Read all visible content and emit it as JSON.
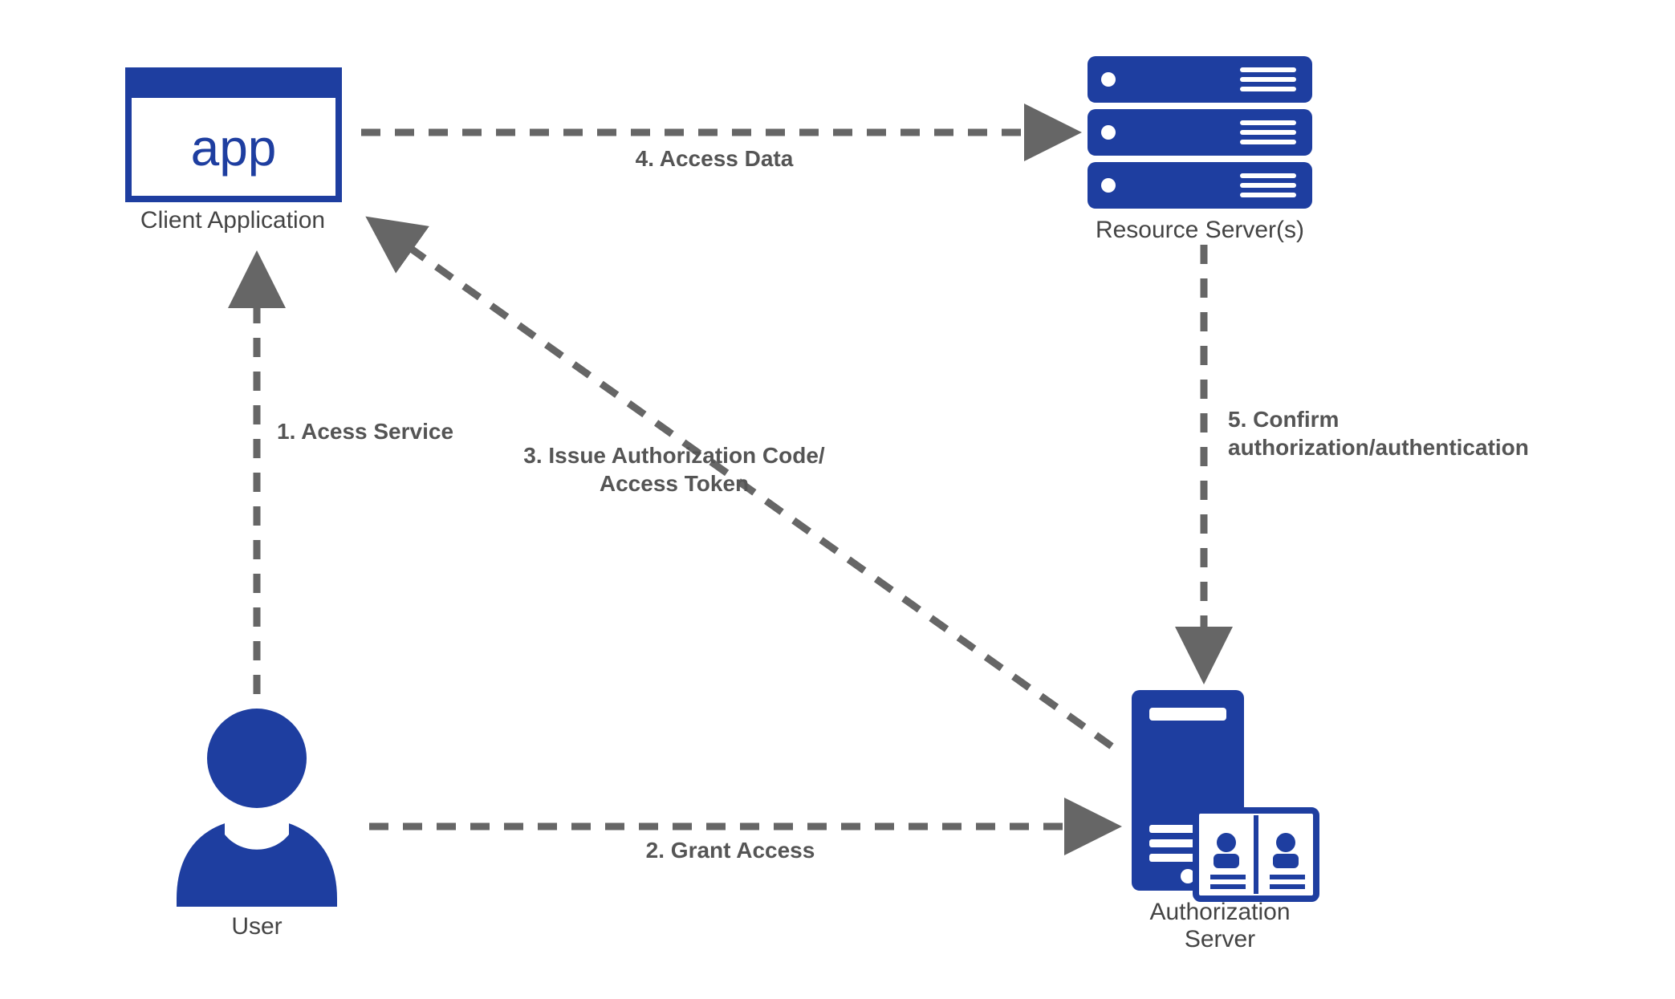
{
  "diagram": {
    "type": "oauth-authorization-flow",
    "nodes": {
      "client_app": {
        "label": "Client Application",
        "icon_text": "app"
      },
      "user": {
        "label": "User"
      },
      "resource_server": {
        "label": "Resource Server(s)"
      },
      "auth_server": {
        "label": "Authorization\nServer"
      }
    },
    "edges": {
      "e1": {
        "label": "1. Acess Service",
        "from": "user",
        "to": "client_app"
      },
      "e2": {
        "label": "2. Grant Access",
        "from": "user",
        "to": "auth_server"
      },
      "e3": {
        "label": "3. Issue Authorization Code/\nAccess Token",
        "from": "auth_server",
        "to": "client_app"
      },
      "e4": {
        "label": "4. Access Data",
        "from": "client_app",
        "to": "resource_server"
      },
      "e5": {
        "label": "5. Confirm\nauthorization/authentication",
        "from": "resource_server",
        "to": "auth_server"
      }
    },
    "colors": {
      "brand_navy": "#1e3ea0",
      "brand_navy_dark": "#17307d",
      "arrow_gray": "#666666",
      "text_gray": "#555555"
    }
  }
}
